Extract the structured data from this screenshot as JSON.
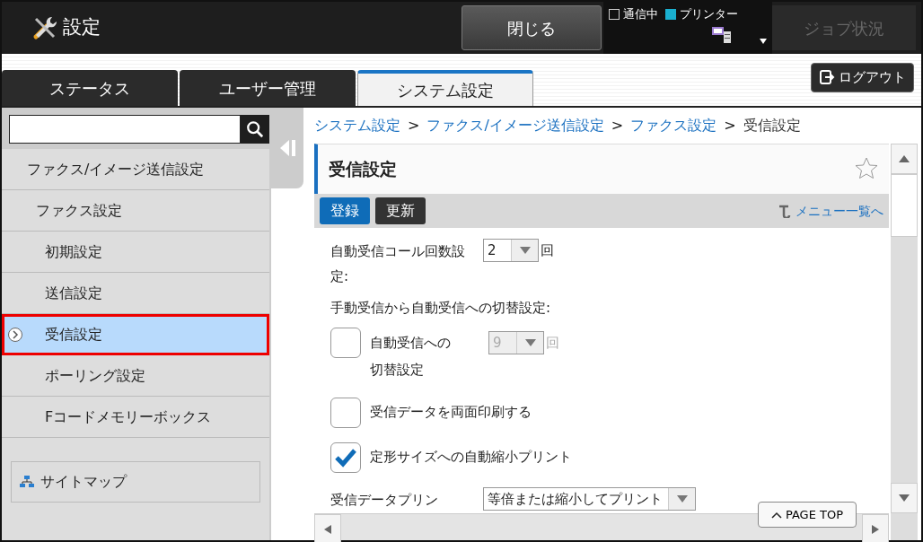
{
  "header": {
    "title": "設定",
    "close_button": "閉じる",
    "indicators": [
      {
        "label": "通信中",
        "on": false
      },
      {
        "label": "プリンター",
        "on": true
      }
    ],
    "job_status": {
      "label": "ジョブ状況",
      "disabled": true
    }
  },
  "tabs": [
    {
      "label": "ステータス",
      "selected": false
    },
    {
      "label": "ユーザー管理",
      "selected": false
    },
    {
      "label": "システム設定",
      "selected": true
    }
  ],
  "logout": "ログアウト",
  "sidebar": {
    "items": [
      {
        "label": "ファクス/イメージ送信設定",
        "selected": false,
        "children": [
          {
            "label": "ファクス設定",
            "selected": false,
            "children": [
              {
                "label": "初期設定",
                "selected": false
              },
              {
                "label": "送信設定",
                "selected": false
              },
              {
                "label": "受信設定",
                "selected": true
              },
              {
                "label": "ポーリング設定",
                "selected": false
              },
              {
                "label": "Fコードメモリーボックス",
                "selected": false
              }
            ]
          }
        ]
      }
    ],
    "sitemap": "サイトマップ"
  },
  "breadcrumb": [
    {
      "label": "システム設定",
      "link": true
    },
    {
      "label": "ファクス/イメージ送信設定",
      "link": true
    },
    {
      "label": "ファクス設定",
      "link": true
    },
    {
      "label": "受信設定",
      "link": false
    }
  ],
  "breadcrumb_separator": ">",
  "page": {
    "title": "受信設定",
    "buttons": [
      {
        "label": "登録",
        "kind": "primary"
      },
      {
        "label": "更新",
        "kind": "dark"
      }
    ],
    "menu_link": "メニュー一覧へ",
    "rows": [
      {
        "kind": "select",
        "label": "自動受信コール回数設定:",
        "value": "2",
        "unit": "回",
        "disabled": false
      },
      {
        "kind": "heading",
        "label": "手動受信から自動受信への切替設定:"
      },
      {
        "kind": "checkselect",
        "label": "自動受信への切替設定",
        "checked": false,
        "value": "9",
        "unit": "回",
        "disabled": true
      },
      {
        "kind": "check",
        "label": "受信データを両面印刷する",
        "checked": false
      },
      {
        "kind": "check",
        "label": "定形サイズへの自動縮小プリント",
        "checked": true
      },
      {
        "kind": "wideselect",
        "label": "受信データプリン",
        "value": "等倍または縮小してプリント"
      }
    ]
  },
  "page_top": "PAGE TOP"
}
